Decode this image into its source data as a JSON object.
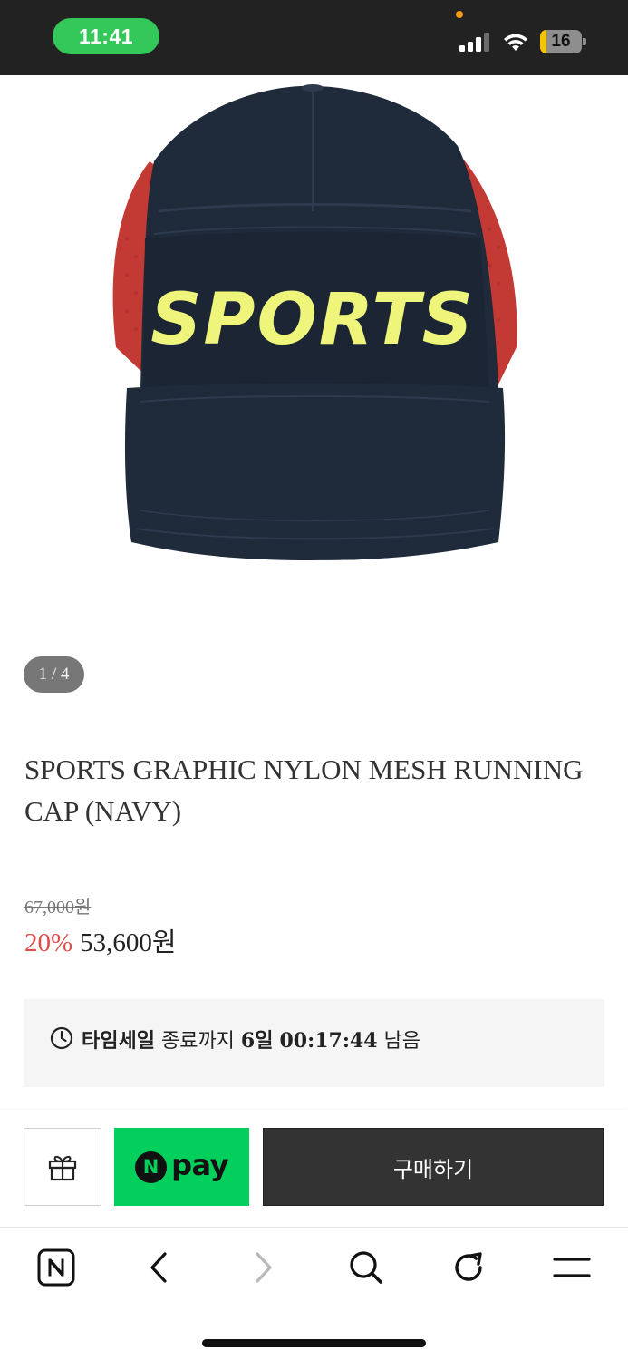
{
  "status_bar": {
    "time": "11:41",
    "battery_level": "16",
    "battery_fraction": 0.16,
    "icons": [
      "signal-icon",
      "wifi-icon",
      "battery-icon"
    ]
  },
  "product": {
    "image_alt": "navy nylon mesh running cap",
    "image_graphic_text": "SPORTS",
    "page_indicator": "1 / 4",
    "title": "SPORTS GRAPHIC NYLON MESH RUNNING CAP (NAVY)",
    "original_price": "67,000원",
    "discount_rate": "20%",
    "sale_price": "53,600원"
  },
  "time_sale": {
    "label": "타임세일",
    "middle": " 종료까지 ",
    "days": "6일",
    "countdown": "00:17:44",
    "suffix": " 남음",
    "icon": "clock-icon"
  },
  "actions": {
    "gift_icon": "gift-icon",
    "npay_logo_letter": "N",
    "npay_label": "pay",
    "buy_label": "구매하기"
  },
  "browser_toolbar": {
    "icons": [
      "naver-home-icon",
      "back-icon",
      "forward-icon",
      "search-icon",
      "refresh-icon",
      "menu-icon"
    ]
  },
  "colors": {
    "status_bar_bg": "#222222",
    "time_pill": "#34c759",
    "discount": "#e04b4b",
    "npay_green": "#03cf5d",
    "buy_button": "#333333",
    "cap_navy": "#1f2a3a",
    "cap_mesh_red": "#c23a33",
    "cap_graphic_yellow": "#eef57a"
  }
}
